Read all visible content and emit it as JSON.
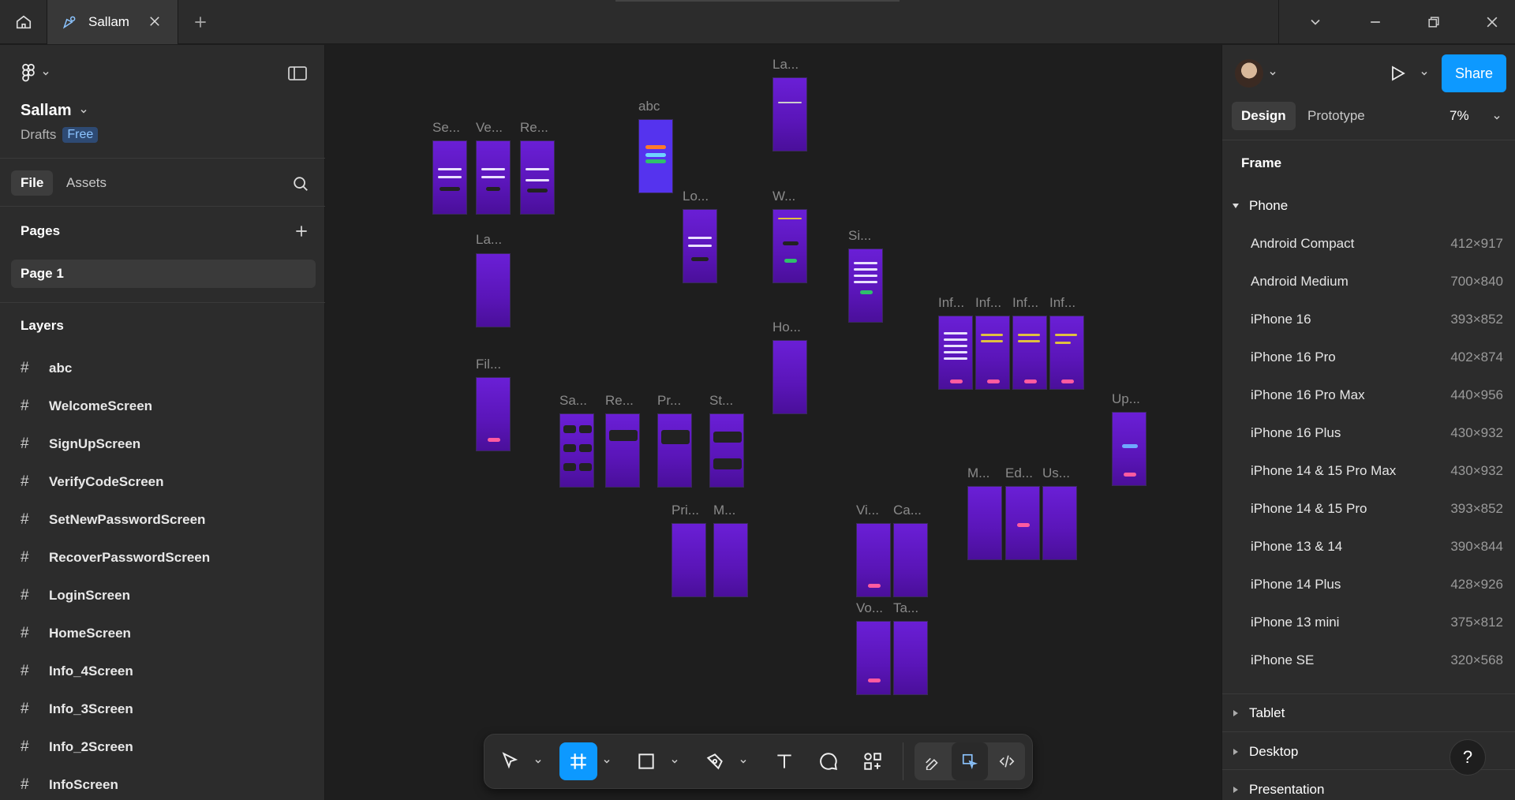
{
  "tab": {
    "title": "Sallam"
  },
  "file": {
    "name": "Sallam",
    "location": "Drafts",
    "plan_badge": "Free"
  },
  "left_tabs": {
    "file": "File",
    "assets": "Assets"
  },
  "pages": {
    "heading": "Pages",
    "items": [
      "Page 1"
    ]
  },
  "layers": {
    "heading": "Layers",
    "items": [
      "abc",
      "WelcomeScreen",
      "SignUpScreen",
      "VerifyCodeScreen",
      "SetNewPasswordScreen",
      "RecoverPasswordScreen",
      "LoginScreen",
      "HomeScreen",
      "Info_4Screen",
      "Info_3Screen",
      "Info_2Screen",
      "InfoScreen"
    ]
  },
  "canvas_labels": {
    "se": "Se...",
    "ve": "Ve...",
    "re1": "Re...",
    "abc": "abc",
    "la1": "La...",
    "lo": "Lo...",
    "w": "W...",
    "la2": "La...",
    "si": "Si...",
    "ho": "Ho...",
    "inf1": "Inf...",
    "inf2": "Inf...",
    "inf3": "Inf...",
    "inf4": "Inf...",
    "fil": "Fil...",
    "sa": "Sa...",
    "re2": "Re...",
    "pr": "Pr...",
    "st": "St...",
    "up": "Up...",
    "m1": "M...",
    "ed": "Ed...",
    "us": "Us...",
    "pri": "Pri...",
    "m2": "M...",
    "vi": "Vi...",
    "ca": "Ca...",
    "vo": "Vo...",
    "ta": "Ta..."
  },
  "right_panel": {
    "share_label": "Share",
    "tabs": {
      "design": "Design",
      "prototype": "Prototype"
    },
    "zoom": "7%",
    "section": "Frame",
    "phone_group": "Phone",
    "presets": [
      {
        "name": "Android Compact",
        "size": "412×917"
      },
      {
        "name": "Android Medium",
        "size": "700×840"
      },
      {
        "name": "iPhone 16",
        "size": "393×852"
      },
      {
        "name": "iPhone 16 Pro",
        "size": "402×874"
      },
      {
        "name": "iPhone 16 Pro Max",
        "size": "440×956"
      },
      {
        "name": "iPhone 16 Plus",
        "size": "430×932"
      },
      {
        "name": "iPhone 14 & 15 Pro Max",
        "size": "430×932"
      },
      {
        "name": "iPhone 14 & 15 Pro",
        "size": "393×852"
      },
      {
        "name": "iPhone 13 & 14",
        "size": "390×844"
      },
      {
        "name": "iPhone 14 Plus",
        "size": "428×926"
      },
      {
        "name": "iPhone 13 mini",
        "size": "375×812"
      },
      {
        "name": "iPhone SE",
        "size": "320×568"
      }
    ],
    "collapsed_groups": [
      "Tablet",
      "Desktop",
      "Presentation"
    ],
    "help": "?"
  },
  "colors": {
    "accent": "#0d99ff",
    "frame_purple": "#6a1fd6",
    "canvas_bg": "#1e1e1e",
    "panel_bg": "#2c2c2c"
  }
}
